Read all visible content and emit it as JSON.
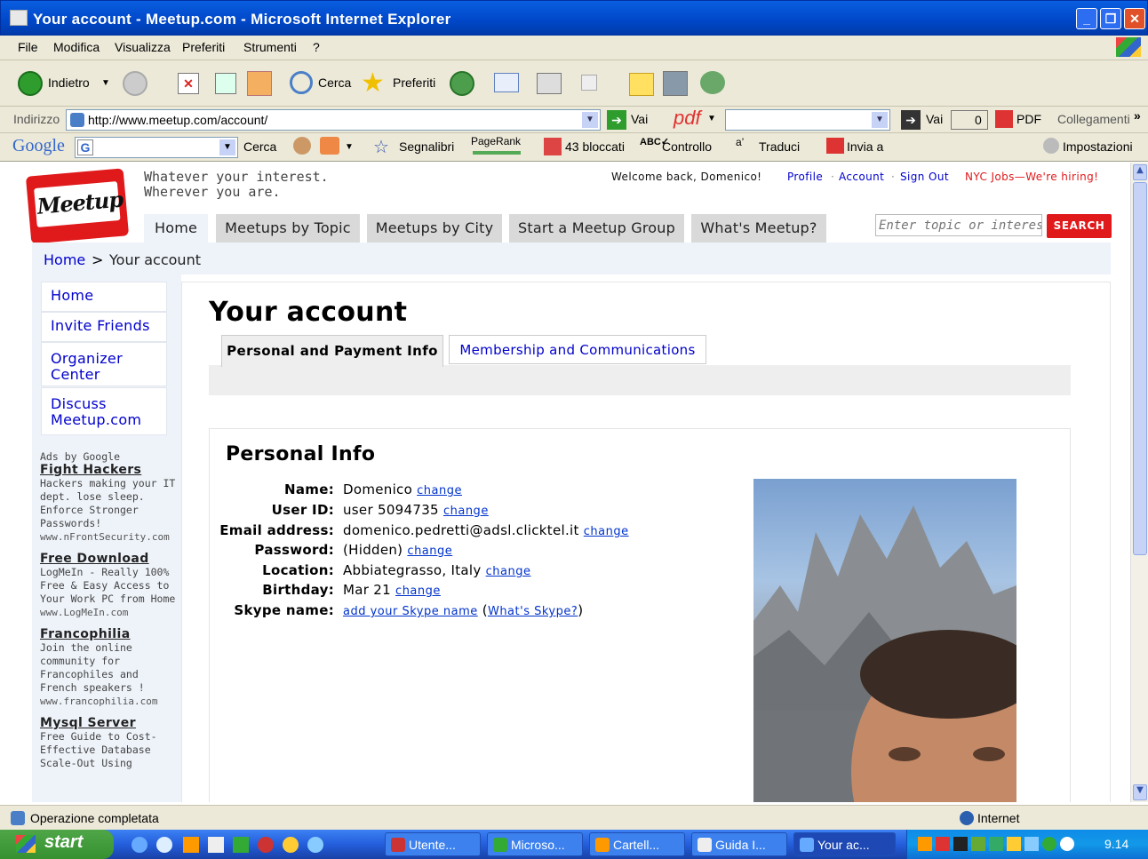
{
  "window": {
    "title": "Your account - Meetup.com - Microsoft Internet Explorer",
    "min": "_",
    "max": "❐",
    "close": "✕"
  },
  "menu": [
    "File",
    "Modifica",
    "Visualizza",
    "Preferiti",
    "Strumenti",
    "?"
  ],
  "toolbar": {
    "back": "Indietro",
    "search": "Cerca",
    "favorites": "Preferiti"
  },
  "address": {
    "label": "Indirizzo",
    "url": "http://www.meetup.com/account/",
    "go": "Vai",
    "pdf": "pdf",
    "go2": "Vai",
    "count": "0",
    "pdf_btn": "PDF",
    "links": "Collegamenti"
  },
  "google_bar": {
    "logo": "Google",
    "search": "Cerca",
    "bookmarks": "Segnalibri",
    "pagerank": "PageRank",
    "blocked": "43 bloccati",
    "check": "Controllo",
    "translate": "Traduci",
    "send": "Invia a",
    "settings": "Impostazioni"
  },
  "page": {
    "logo_text": "Meetup",
    "tagline_1": "Whatever your interest.",
    "tagline_2": "Wherever you are.",
    "welcome": "Welcome back, Domenico!",
    "top_links": {
      "profile": "Profile",
      "account": "Account",
      "sign_out": "Sign Out",
      "jobs": "NYC Jobs—We're hiring!"
    },
    "nav": [
      "Home",
      "Meetups by Topic",
      "Meetups by City",
      "Start a Meetup Group",
      "What's Meetup?"
    ],
    "search": {
      "placeholder": "Enter topic or interest",
      "button": "SEARCH"
    },
    "breadcrumb": {
      "home": "Home",
      "sep": ">",
      "current": "Your account"
    },
    "sidebar": [
      {
        "label": "Home"
      },
      {
        "label": "Invite Friends"
      },
      {
        "label": "Organizer Center"
      },
      {
        "label": "Discuss Meetup.com"
      }
    ],
    "ads": {
      "header": "Ads by Google",
      "items": [
        {
          "title": "Fight Hackers",
          "body": "Hackers making your IT dept. lose sleep. Enforce Stronger Passwords!",
          "url": "www.nFrontSecurity.com"
        },
        {
          "title": "Free Download",
          "body": "LogMeIn - Really 100% Free & Easy Access to Your Work PC from Home",
          "url": "www.LogMeIn.com"
        },
        {
          "title": "Francophilia",
          "body": "Join the online community for Francophiles and French speakers !",
          "url": "www.francophilia.com"
        },
        {
          "title": "Mysql Server",
          "body": "Free Guide to Cost-Effective Database Scale-Out Using",
          "url": ""
        }
      ]
    },
    "heading": "Your account",
    "tabs": {
      "active": "Personal and Payment Info",
      "other": "Membership and Communications"
    },
    "personal": {
      "title": "Personal Info",
      "change": "change",
      "rows": [
        {
          "label": "Name:",
          "value": "Domenico"
        },
        {
          "label": "User ID:",
          "value": "user 5094735"
        },
        {
          "label": "Email address:",
          "value": "domenico.pedretti@adsl.clicktel.it"
        },
        {
          "label": "Password:",
          "value": "(Hidden)"
        },
        {
          "label": "Location:",
          "value": "Abbiategrasso, Italy"
        },
        {
          "label": "Birthday:",
          "value": "Mar 21"
        }
      ],
      "skype_label": "Skype name:",
      "skype_add": "add your Skype name",
      "skype_what": "What's Skype?"
    }
  },
  "status": {
    "text": "Operazione completata",
    "zone": "Internet"
  },
  "taskbar": {
    "start": "start",
    "tasks": [
      "Utente...",
      "Microso...",
      "Cartell...",
      "Guida I...",
      "Your ac..."
    ],
    "clock": "9.14"
  },
  "colors": {
    "meetup_red": "#e0191b",
    "link_blue": "#0033cc",
    "xp_blue": "#0047c8"
  }
}
